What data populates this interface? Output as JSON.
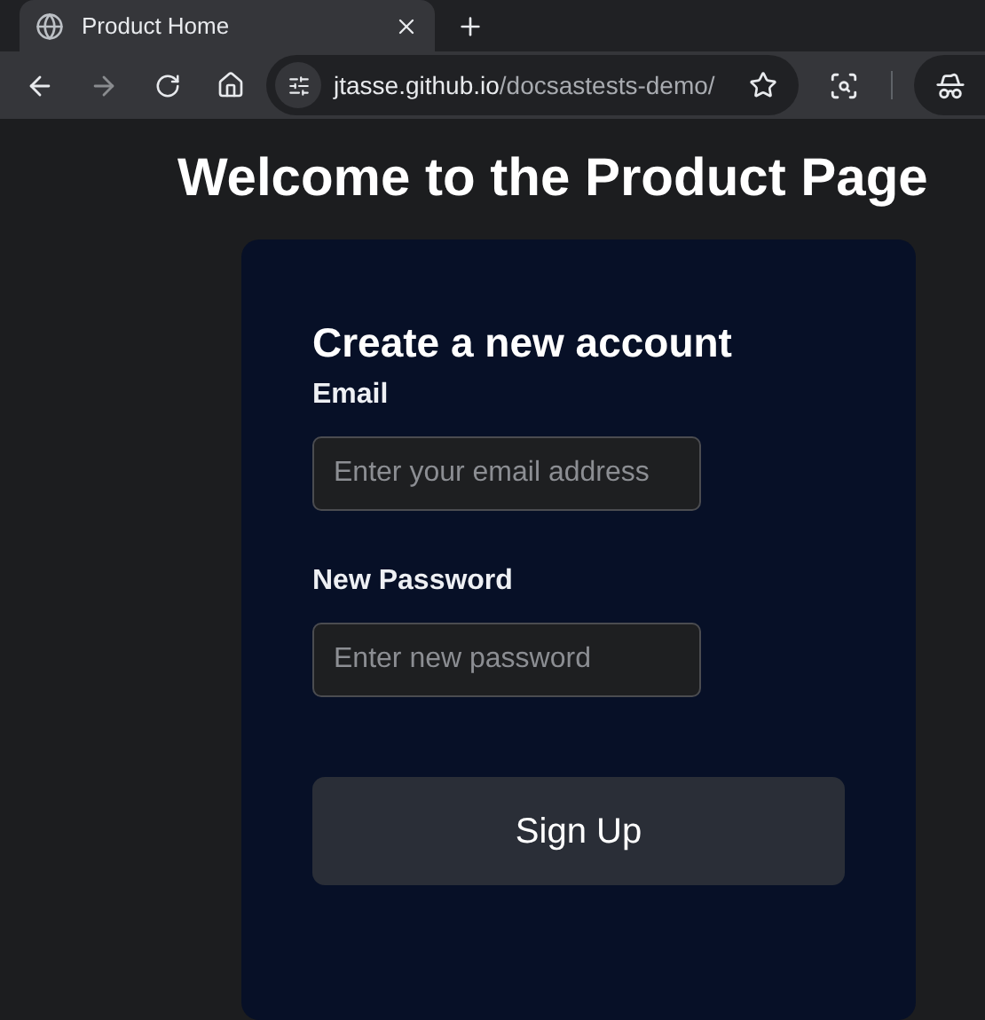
{
  "browser": {
    "tab": {
      "title": "Product Home"
    },
    "address": {
      "host": "jtasse.github.io",
      "path": "/docsastests-demo/"
    }
  },
  "page": {
    "heading": "Welcome to the Product Page",
    "form": {
      "title": "Create a new account",
      "fields": [
        {
          "label": "Email",
          "placeholder": "Enter your email address"
        },
        {
          "label": "New Password",
          "placeholder": "Enter new password"
        }
      ],
      "submit": "Sign Up"
    }
  }
}
